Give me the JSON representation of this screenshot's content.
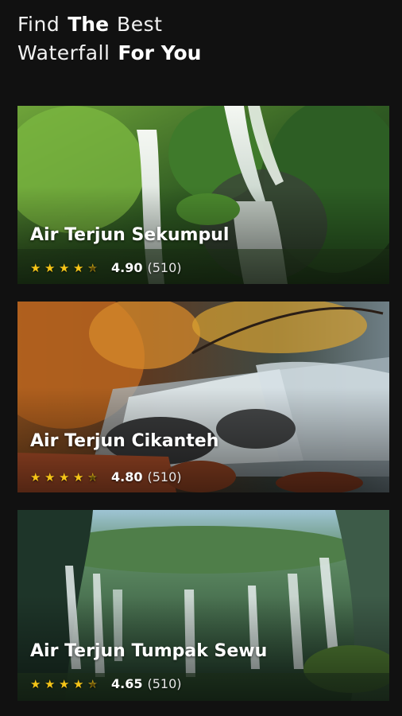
{
  "header": {
    "line1_light": "Find",
    "line1_bold": "The",
    "line1_tail": "Best",
    "line2_light": "Waterfall",
    "line2_bold": "For You"
  },
  "colors": {
    "background": "#111111",
    "star": "#f5c518"
  },
  "waterfalls": [
    {
      "name": "Air Terjun Sekumpul",
      "rating": "4.90",
      "reviews": "(510)",
      "stars": 4.5
    },
    {
      "name": "Air Terjun Cikanteh",
      "rating": "4.80",
      "reviews": "(510)",
      "stars": 4.5
    },
    {
      "name": "Air Terjun Tumpak Sewu",
      "rating": "4.65",
      "reviews": "(510)",
      "stars": 4.5
    }
  ]
}
